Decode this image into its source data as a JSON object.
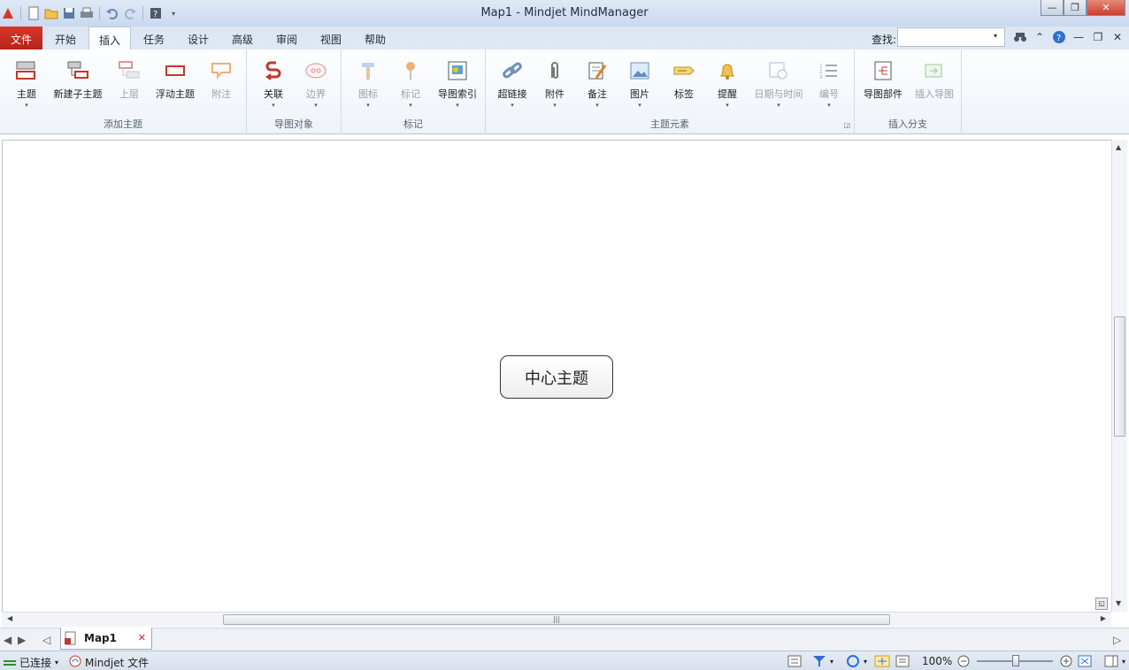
{
  "window": {
    "title": "Map1 - Mindjet MindManager"
  },
  "tabs": [
    {
      "label": "文件"
    },
    {
      "label": "开始"
    },
    {
      "label": "插入"
    },
    {
      "label": "任务"
    },
    {
      "label": "设计"
    },
    {
      "label": "高级"
    },
    {
      "label": "审阅"
    },
    {
      "label": "视图"
    },
    {
      "label": "帮助"
    }
  ],
  "search": {
    "label": "查找:",
    "value": ""
  },
  "ribbon": {
    "groups": [
      {
        "label": "添加主题",
        "buttons": [
          "主题",
          "新建子主题",
          "上层",
          "浮动主题",
          "附注"
        ]
      },
      {
        "label": "导图对象",
        "buttons": [
          "关联",
          "边界"
        ]
      },
      {
        "label": "标记",
        "buttons": [
          "图标",
          "标记",
          "导图索引"
        ]
      },
      {
        "label": "主题元素",
        "buttons": [
          "超链接",
          "附件",
          "备注",
          "图片",
          "标签",
          "提醒",
          "日期与时间",
          "编号"
        ]
      },
      {
        "label": "插入分支",
        "buttons": [
          "导图部件",
          "插入导图"
        ]
      }
    ]
  },
  "canvas": {
    "central_topic": "中心主题"
  },
  "doc_tabs": [
    {
      "label": "Map1"
    }
  ],
  "status": {
    "connection": "已连接",
    "files": "Mindjet 文件",
    "zoom": "100%"
  },
  "colors": {
    "accent": "#d9372a",
    "ribbon_bg": "#eef3f9"
  }
}
